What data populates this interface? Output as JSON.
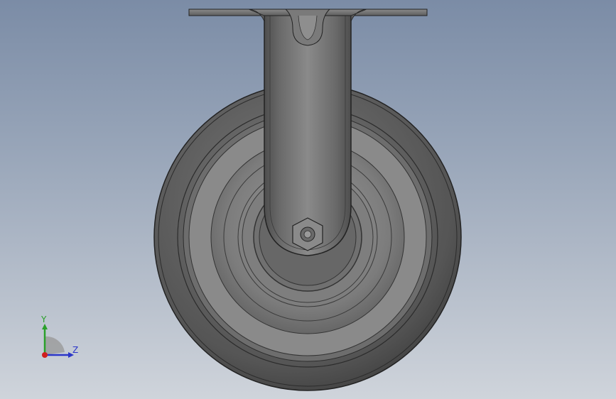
{
  "viewport": {
    "background_top": "#7b8ca6",
    "background_bottom": "#cfd4db"
  },
  "model": {
    "name": "caster-wheel",
    "part_color": "#6e6e6e",
    "tire_color": "#4f4f4f"
  },
  "triad": {
    "y_label": "Y",
    "z_label": "Z",
    "y_color": "#2aa02a",
    "z_color": "#2b36c8",
    "x_color": "#d01e1e"
  }
}
